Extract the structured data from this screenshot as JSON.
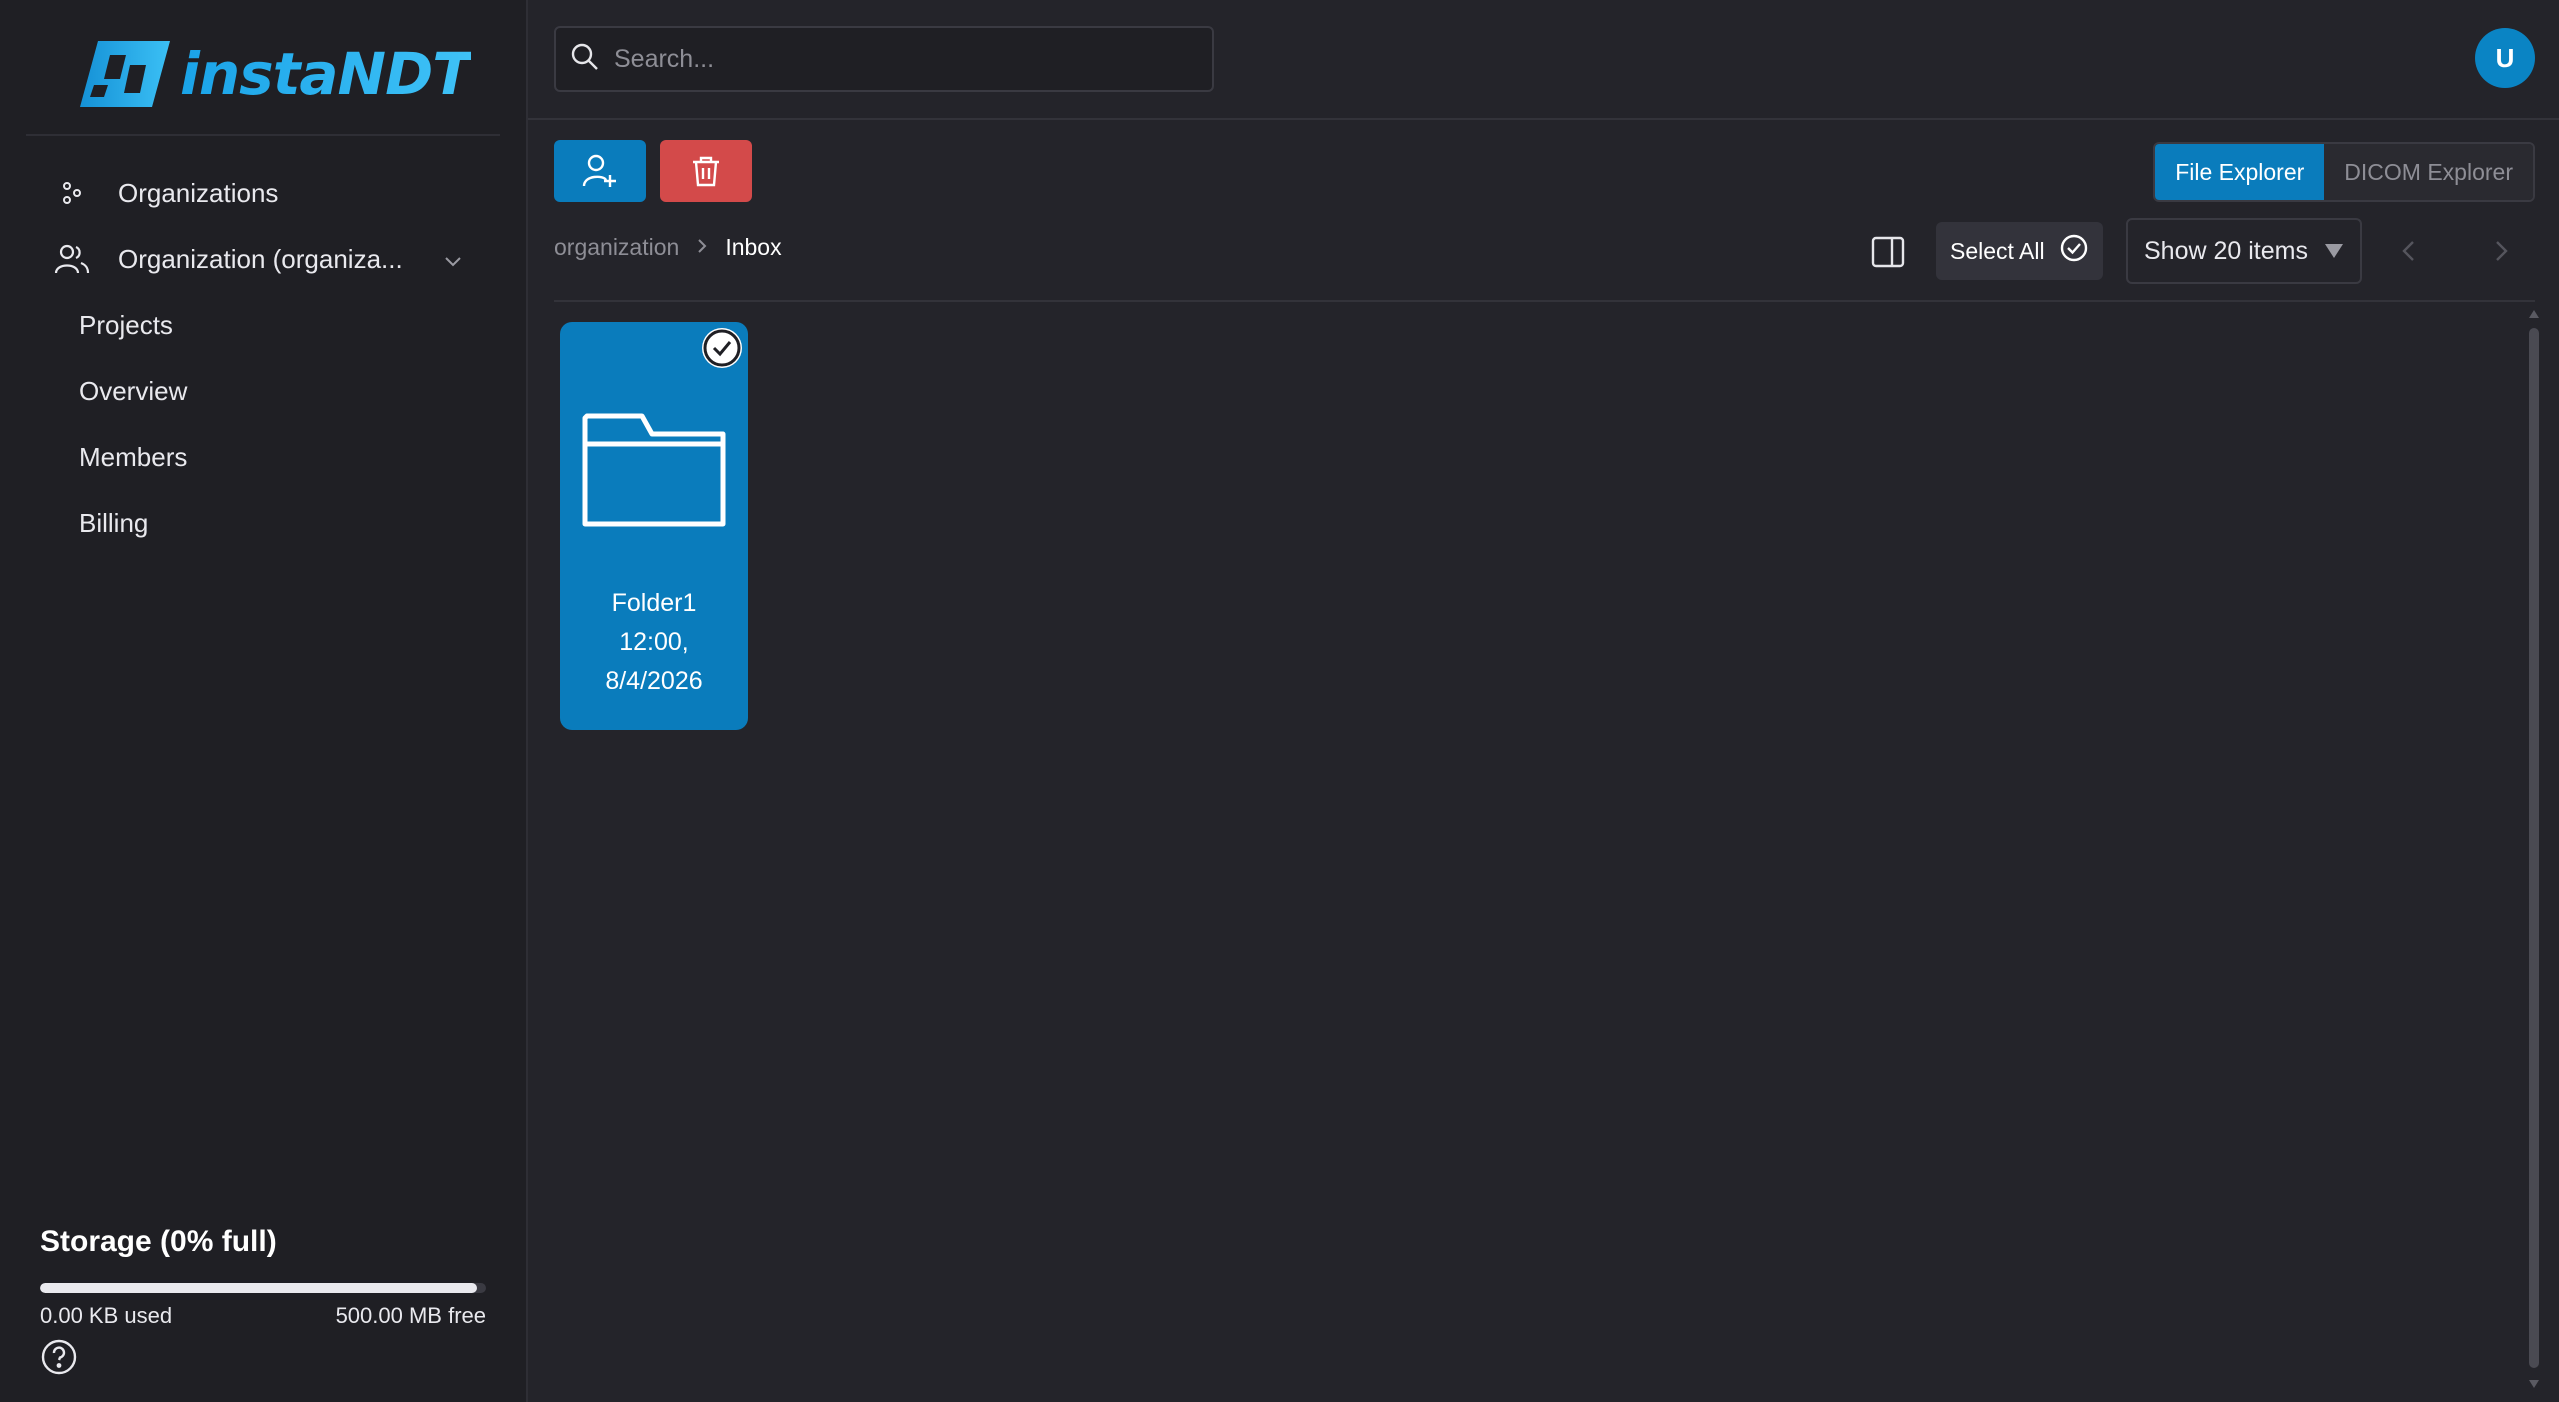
{
  "brand": {
    "name": "instaNDT",
    "accent": "#0a7cbc",
    "danger": "#d34a4a"
  },
  "sidebar": {
    "items": [
      {
        "label": "Organizations",
        "icon": "organizations-icon"
      },
      {
        "label": "Organization (organiza...",
        "icon": "users-icon",
        "expanded": true
      }
    ],
    "sub_items": [
      {
        "label": "Projects"
      },
      {
        "label": "Overview"
      },
      {
        "label": "Members"
      },
      {
        "label": "Billing"
      }
    ],
    "storage": {
      "title": "Storage (0% full)",
      "used": "0.00 KB used",
      "free": "500.00 MB free",
      "fraction": 0.98
    }
  },
  "header": {
    "search_placeholder": "Search...",
    "avatar_initial": "U"
  },
  "toolbar": {
    "tabs": [
      {
        "label": "File Explorer",
        "active": true
      },
      {
        "label": "DICOM Explorer",
        "active": false
      }
    ],
    "select_all_label": "Select All",
    "page_size_label": "Show 20 items"
  },
  "breadcrumb": {
    "root": "organization",
    "current": "Inbox"
  },
  "items": [
    {
      "name": "Folder1",
      "time": "12:00,",
      "date": "8/4/2026",
      "selected": true
    }
  ]
}
